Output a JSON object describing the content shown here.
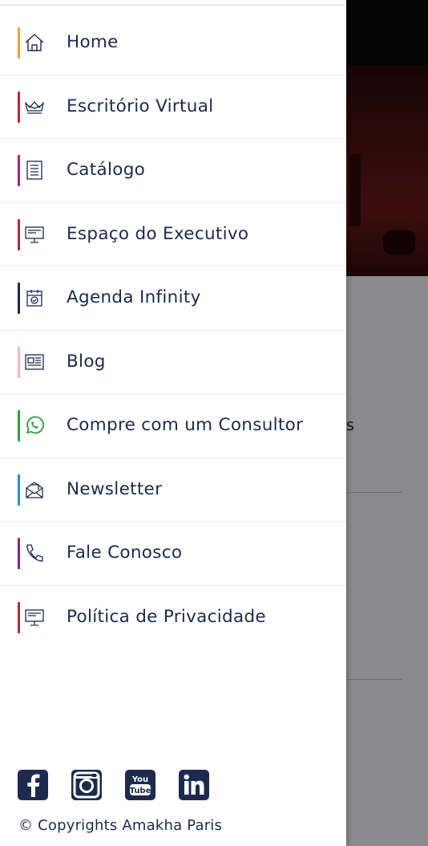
{
  "background": {
    "fragment_text": "s"
  },
  "menu": {
    "items": [
      {
        "label": "Home",
        "icon": "home-icon",
        "accent": "#e8a23a"
      },
      {
        "label": "Escritório Virtual",
        "icon": "crown-icon",
        "accent": "#c0273a"
      },
      {
        "label": "Catálogo",
        "icon": "catalog-icon",
        "accent": "#a4267a"
      },
      {
        "label": "Espaço do Executivo",
        "icon": "monitor-icon",
        "accent": "#b12a3c"
      },
      {
        "label": "Agenda Infinity",
        "icon": "calendar-icon",
        "accent": "#1d2a4d"
      },
      {
        "label": "Blog",
        "icon": "newspaper-icon",
        "accent": "#f0b8c4"
      },
      {
        "label": "Compre com um Consultor",
        "icon": "whatsapp-icon",
        "accent": "#2c9e3a"
      },
      {
        "label": "Newsletter",
        "icon": "envelope-icon",
        "accent": "#2d8fc4"
      },
      {
        "label": "Fale Conosco",
        "icon": "phone-icon",
        "accent": "#7b2b7a"
      },
      {
        "label": "Política de Privacidade",
        "icon": "monitor-icon",
        "accent": "#b12a3c"
      }
    ]
  },
  "social": [
    "facebook-icon",
    "instagram-icon",
    "youtube-icon",
    "linkedin-icon"
  ],
  "footer": {
    "copyright": "© Copyrights Amakha Paris"
  },
  "colors": {
    "text": "#1d2a4d",
    "overlay": "#8a8a8c"
  }
}
